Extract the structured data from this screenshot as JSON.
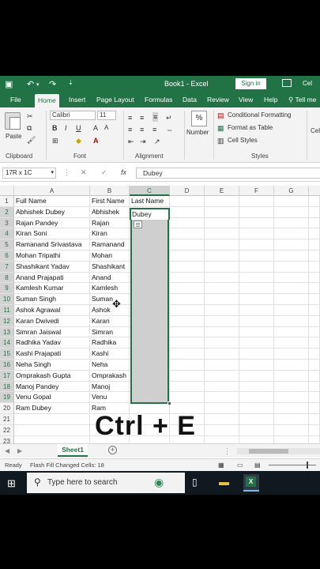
{
  "window": {
    "title": "Book1 - Excel",
    "sign_in": "Sign in",
    "right_label": "Cel",
    "tell_me": "Tell me"
  },
  "tabs": [
    "File",
    "Home",
    "Insert",
    "Page Layout",
    "Formulas",
    "Data",
    "Review",
    "View",
    "Help"
  ],
  "active_tab": "Home",
  "ribbon": {
    "font_name": "Calibri",
    "font_size": "11",
    "number_label": "Number",
    "percent": "%",
    "conditional_formatting": "Conditional Formatting",
    "format_as_table": "Format as Table",
    "cell_styles": "Cell Styles",
    "groups": {
      "clipboard": "Clipboard",
      "font": "Font",
      "alignment": "Alignment",
      "styles": "Styles"
    },
    "paste_label": "Paste"
  },
  "formula_bar": {
    "name_box": "17R x 1C",
    "fx": "fx",
    "value": "Dubey"
  },
  "columns": [
    "A",
    "B",
    "C",
    "D",
    "E",
    "F",
    "G"
  ],
  "rows": [
    {
      "n": "1",
      "a": "Full Name",
      "b": "First Name",
      "c": "Last Name"
    },
    {
      "n": "2",
      "a": "Abhishek Dubey",
      "b": "Abhishek",
      "c": "Dubey"
    },
    {
      "n": "3",
      "a": "Rajan Pandey",
      "b": "Rajan",
      "c": ""
    },
    {
      "n": "4",
      "a": "Kiran Soni",
      "b": "Kiran",
      "c": ""
    },
    {
      "n": "5",
      "a": "Ramanand Srivastava",
      "b": "Ramanand",
      "c": ""
    },
    {
      "n": "6",
      "a": "Mohan Tripathi",
      "b": "Mohan",
      "c": ""
    },
    {
      "n": "7",
      "a": "Shashikant Yadav",
      "b": "Shashikant",
      "c": ""
    },
    {
      "n": "8",
      "a": "Anand Prajapati",
      "b": "Anand",
      "c": ""
    },
    {
      "n": "9",
      "a": "Kamlesh Kumar",
      "b": "Kamlesh",
      "c": ""
    },
    {
      "n": "10",
      "a": "Suman Singh",
      "b": "Suman",
      "c": ""
    },
    {
      "n": "11",
      "a": "Ashok Agrawal",
      "b": "Ashok",
      "c": ""
    },
    {
      "n": "12",
      "a": "Karan Dwivedi",
      "b": "Karan",
      "c": ""
    },
    {
      "n": "13",
      "a": "Simran Jaiswal",
      "b": "Simran",
      "c": ""
    },
    {
      "n": "14",
      "a": "Radhika Yadav",
      "b": "Radhika",
      "c": ""
    },
    {
      "n": "15",
      "a": "Kashi Prajapati",
      "b": "Kashi",
      "c": ""
    },
    {
      "n": "16",
      "a": "Neha Singh",
      "b": "Neha",
      "c": ""
    },
    {
      "n": "17",
      "a": "Omprakash Gupta",
      "b": "Omprakash",
      "c": ""
    },
    {
      "n": "18",
      "a": "Manoj Pandey",
      "b": "Manoj",
      "c": ""
    },
    {
      "n": "19",
      "a": "Venu Gopal",
      "b": "Venu",
      "c": ""
    },
    {
      "n": "20",
      "a": "Ram Dubey",
      "b": "Ram",
      "c": ""
    },
    {
      "n": "21",
      "a": "",
      "b": "",
      "c": ""
    },
    {
      "n": "22",
      "a": "",
      "b": "",
      "c": ""
    },
    {
      "n": "23",
      "a": "",
      "b": "",
      "c": ""
    }
  ],
  "sheet": {
    "name": "Sheet1",
    "add": "+"
  },
  "status": {
    "ready": "Ready",
    "message": "Flash Fill Changed Cells: 18"
  },
  "taskbar": {
    "search_placeholder": "Type here to search"
  },
  "overlay": {
    "shortcut": "Ctrl + E"
  },
  "colors": {
    "excel_green": "#217346",
    "selection_gray": "#cfcfcf"
  }
}
